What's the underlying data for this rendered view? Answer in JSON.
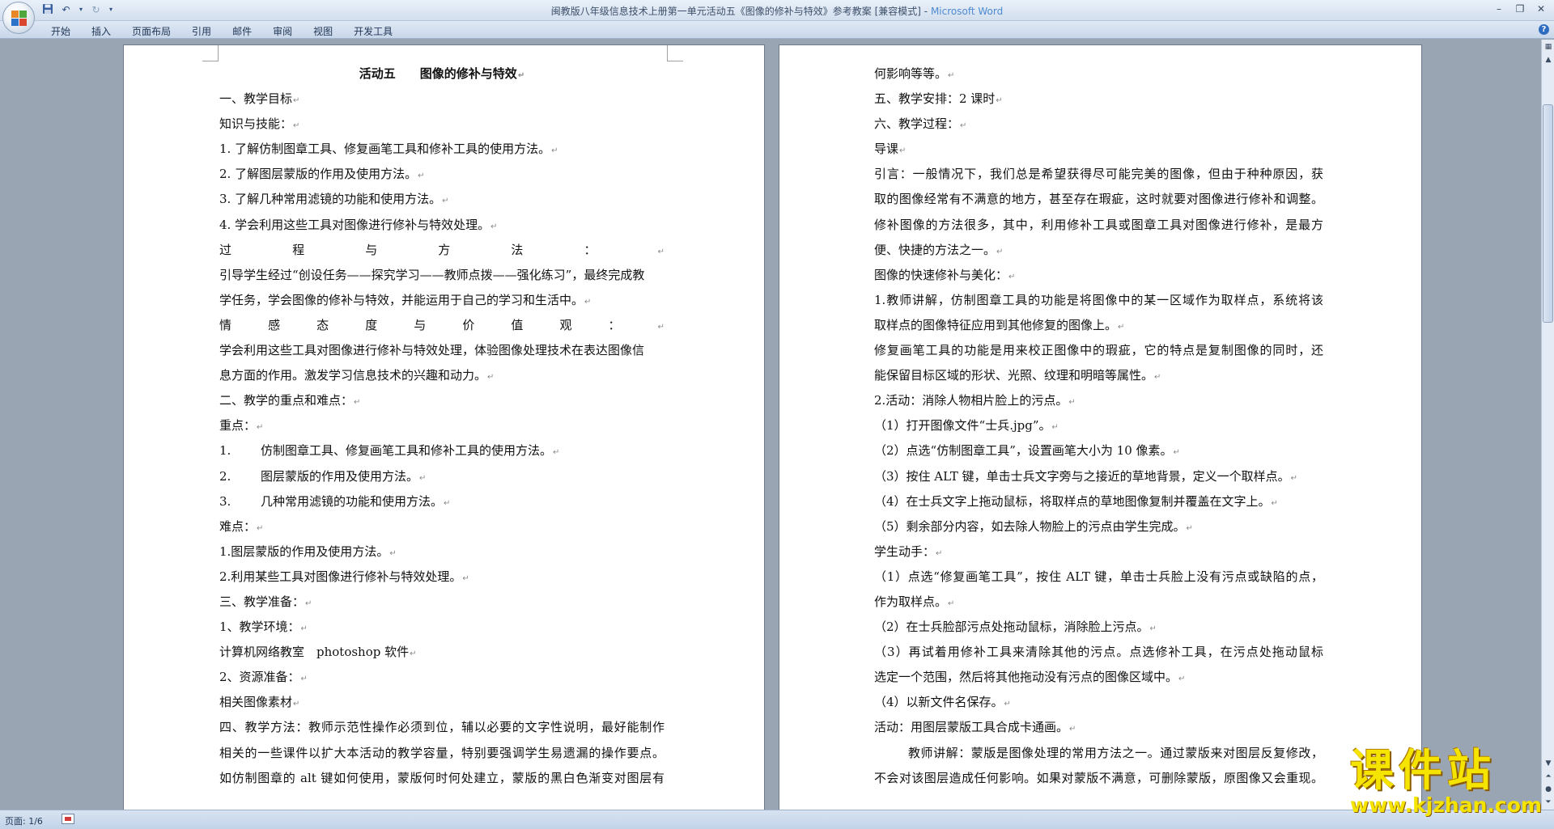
{
  "window": {
    "title": "闽教版八年级信息技术上册第一单元活动五《图像的修补与特效》参考教案 [兼容模式]",
    "app_name": "Microsoft Word",
    "separator": " - "
  },
  "qat": {
    "save_icon": "save-icon",
    "undo_icon": "undo-icon",
    "redo_icon": "redo-icon",
    "customize_icon": "dropdown-icon"
  },
  "ribbon": {
    "tabs": [
      "开始",
      "插入",
      "页面布局",
      "引用",
      "邮件",
      "审阅",
      "视图",
      "开发工具"
    ]
  },
  "paragraph_mark": "↵",
  "pages": {
    "left": {
      "title": "活动五　　图像的修补与特效",
      "lines": [
        "一、教学目标",
        "知识与技能：",
        "1. 了解仿制图章工具、修复画笔工具和修补工具的使用方法。",
        "2. 了解图层蒙版的作用及使用方法。",
        "3. 了解几种常用滤镜的功能和使用方法。",
        "4. 学会利用这些工具对图像进行修补与特效处理。",
        "过程与方法：",
        "引导学生经过“创设任务——探究学习——教师点拨——强化练习”，最终完成教",
        "学任务，学会图像的修补与特效，并能运用于自己的学习和生活中。",
        "情感态度与价值观：",
        "学会利用这些工具对图像进行修补与特效处理，体验图像处理技术在表达图像信",
        "息方面的作用。激发学习信息技术的兴趣和动力。",
        "二、教学的重点和难点：",
        "重点：",
        "仿制图章工具、修复画笔工具和修补工具的使用方法。",
        "图层蒙版的作用及使用方法。",
        "几种常用滤镜的功能和使用方法。",
        "难点：",
        "1.图层蒙版的作用及使用方法。",
        "2.利用某些工具对图像进行修补与特效处理。",
        "三、教学准备：",
        "1、教学环境：",
        "计算机网络教室　photoshop 软件",
        "2、资源准备：",
        "相关图像素材",
        "四、教学方法：教师示范性操作必须到位，辅以必要的文字性说明，最好能制作",
        "相关的一些课件以扩大本活动的教学容量，特别要强调学生易遗漏的操作要点。",
        "如仿制图章的 alt 键如何使用，蒙版何时何处建立，蒙版的黑白色渐变对图层有"
      ],
      "numbered": [
        "1.",
        "2.",
        "3."
      ]
    },
    "right": {
      "lines": [
        "何影响等等。",
        "五、教学安排：2 课时",
        "六、教学过程：",
        "导课",
        "引言：一般情况下，我们总是希望获得尽可能完美的图像，但由于种种原因，获",
        "取的图像经常有不满意的地方，甚至存在瑕疵，这时就要对图像进行修补和调整。",
        "修补图像的方法很多，其中，利用修补工具或图章工具对图像进行修补，是最方",
        "便、快捷的方法之一。",
        "图像的快速修补与美化：",
        "1.教师讲解，仿制图章工具的功能是将图像中的某一区域作为取样点，系统将该",
        "取样点的图像特征应用到其他修复的图像上。",
        "修复画笔工具的功能是用来校正图像中的瑕疵，它的特点是复制图像的同时，还",
        "能保留目标区域的形状、光照、纹理和明暗等属性。",
        "2.活动：消除人物相片脸上的污点。",
        "（1）打开图像文件“士兵.jpg”。",
        "（2）点选“仿制图章工具”，设置画笔大小为 10 像素。",
        "（3）按住 ALT 键，单击士兵文字旁与之接近的草地背景，定义一个取样点。",
        "（4）在士兵文字上拖动鼠标，将取样点的草地图像复制并覆盖在文字上。",
        "（5）剩余部分内容，如去除人物脸上的污点由学生完成。",
        "学生动手：",
        "（1）点选“修复画笔工具”，按住 ALT 键，单击士兵脸上没有污点或缺陷的点，",
        "作为取样点。",
        "（2）在士兵脸部污点处拖动鼠标，消除脸上污点。",
        "（3）再试着用修补工具来清除其他的污点。点选修补工具，在污点处拖动鼠标",
        "选定一个范围，然后将其他拖动没有污点的图像区域中。",
        "（4）以新文件名保存。",
        "活动：用图层蒙版工具合成卡通画。",
        "教师讲解：蒙版是图像处理的常用方法之一。通过蒙版来对图层反复修改，",
        "不会对该图层造成任何影响。如果对蒙版不满意，可删除蒙版，原图像又会重现。"
      ]
    }
  },
  "status": {
    "page_info": "页面: 1/6"
  },
  "watermark": {
    "title": "课件站",
    "url": "www.kjzhan.com"
  },
  "colors": {
    "office_orange": "#e8862a",
    "office_green": "#4fa63b",
    "office_blue": "#2f73c8",
    "office_red": "#d9452e",
    "watermark_yellow": "#f4e400"
  }
}
